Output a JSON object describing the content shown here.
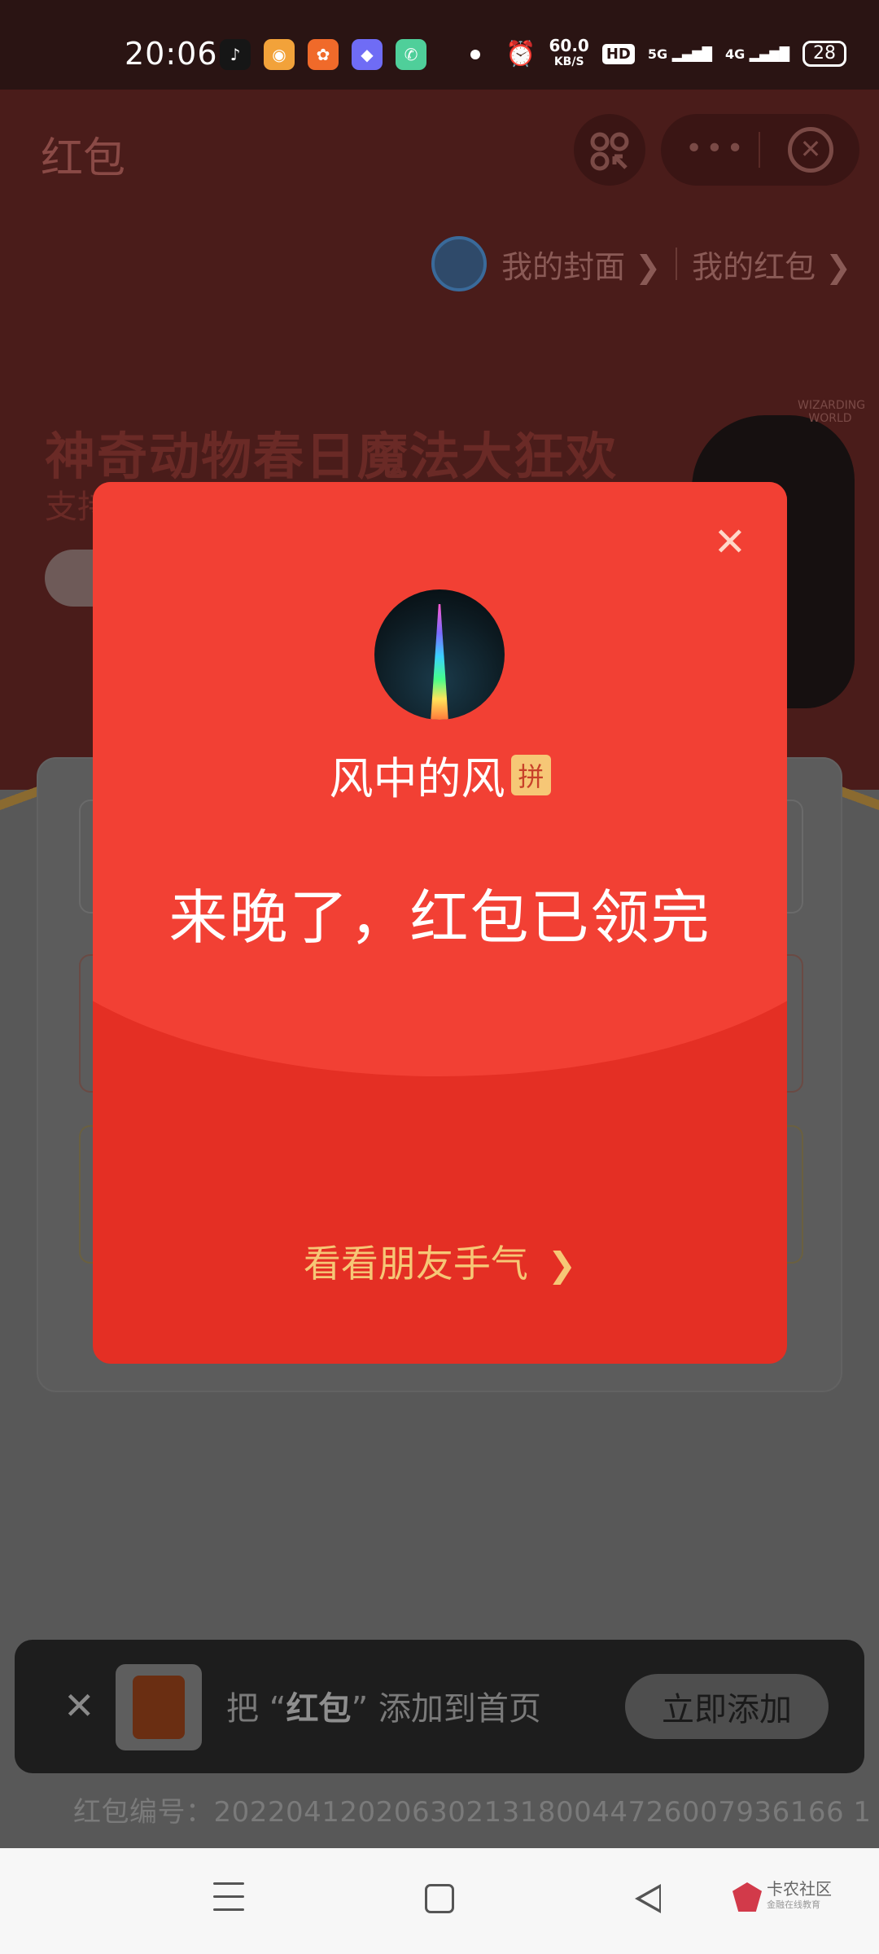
{
  "status_bar": {
    "time": "20:06",
    "net_speed": "60.0",
    "net_speed_unit": "KB/S",
    "hd_label": "HD",
    "signal_5g": "5G",
    "signal_4g": "4G",
    "battery": "28",
    "notification_icons": [
      "douyin-icon",
      "weibo-icon",
      "uc-browser-icon",
      "app-icon",
      "phone-icon"
    ]
  },
  "page": {
    "title": "红包",
    "my_cover_link": "我的封面",
    "my_redpacket_link": "我的红包",
    "banner_title": "神奇动物春日魔法大狂欢",
    "banner_sub": "支持",
    "brand_logo": "WIZARDING WORLD"
  },
  "modal": {
    "sender_name": "风中的风",
    "badge": "拼",
    "message": "来晚了，红包已领完",
    "friends_link": "看看朋友手气"
  },
  "toast": {
    "prefix": "把 “",
    "app_name": "红包",
    "suffix": "” 添加到首页",
    "button": "立即添加"
  },
  "serial_label": "红包编号：",
  "serial_number": "20220412020630213180044726007936166 1",
  "watermark": {
    "title": "卡农社区",
    "subtitle": "金融在线教育"
  },
  "colors": {
    "packet_red": "#f24034",
    "packet_dark_red": "#e42f24",
    "gold_text": "#f6c776"
  }
}
